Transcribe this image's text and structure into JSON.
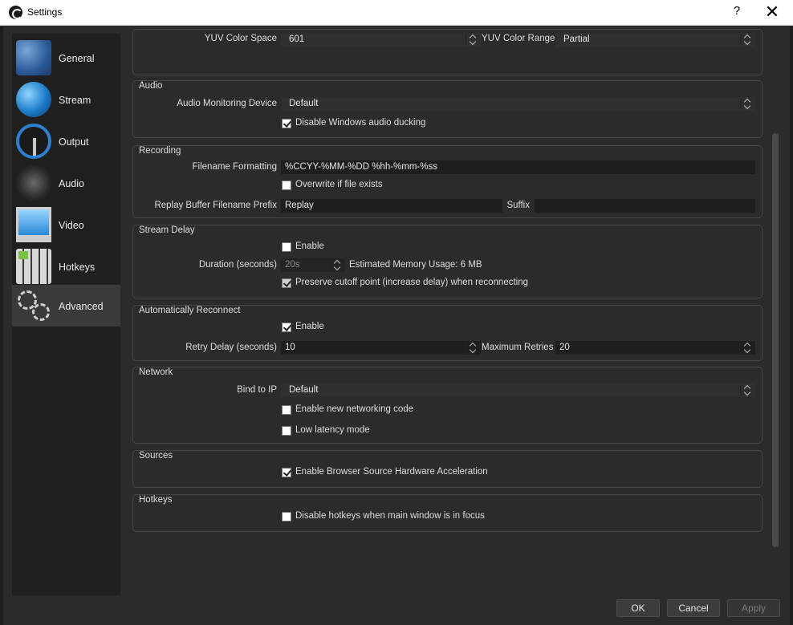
{
  "window": {
    "title": "Settings",
    "help_label": "?",
    "close_label": "✕"
  },
  "sidebar": {
    "items": [
      {
        "label": "General",
        "icon": "general-icon"
      },
      {
        "label": "Stream",
        "icon": "globe-icon"
      },
      {
        "label": "Output",
        "icon": "output-dial-icon"
      },
      {
        "label": "Audio",
        "icon": "speaker-icon"
      },
      {
        "label": "Video",
        "icon": "monitor-icon"
      },
      {
        "label": "Hotkeys",
        "icon": "keyboard-icon"
      },
      {
        "label": "Advanced",
        "icon": "gears-icon"
      }
    ],
    "active": "Advanced"
  },
  "video_top": {
    "color_space_label": "YUV Color Space",
    "color_space_value": "601",
    "color_range_label": "YUV Color Range",
    "color_range_value": "Partial"
  },
  "audio": {
    "title": "Audio",
    "monitoring_label": "Audio Monitoring Device",
    "monitoring_value": "Default",
    "ducking_label": "Disable Windows audio ducking",
    "ducking_checked": true
  },
  "recording": {
    "title": "Recording",
    "filename_label": "Filename Formatting",
    "filename_value": "%CCYY-%MM-%DD %hh-%mm-%ss",
    "overwrite_label": "Overwrite if file exists",
    "overwrite_checked": false,
    "replay_label": "Replay Buffer Filename Prefix",
    "replay_value": "Replay",
    "suffix_label": "Suffix",
    "suffix_value": ""
  },
  "stream_delay": {
    "title": "Stream Delay",
    "enable_label": "Enable",
    "enable_checked": false,
    "duration_label": "Duration (seconds)",
    "duration_value": "20s",
    "memory_label": "Estimated Memory Usage: 6 MB",
    "preserve_label": "Preserve cutoff point (increase delay) when reconnecting",
    "preserve_checked": true
  },
  "reconnect": {
    "title": "Automatically Reconnect",
    "enable_label": "Enable",
    "enable_checked": true,
    "retry_label": "Retry Delay (seconds)",
    "retry_value": "10",
    "max_label": "Maximum Retries",
    "max_value": "20"
  },
  "network": {
    "title": "Network",
    "bind_label": "Bind to IP",
    "bind_value": "Default",
    "new_net_label": "Enable new networking code",
    "new_net_checked": false,
    "low_latency_label": "Low latency mode",
    "low_latency_checked": false
  },
  "sources": {
    "title": "Sources",
    "browser_accel_label": "Enable Browser Source Hardware Acceleration",
    "browser_accel_checked": true
  },
  "hotkeys": {
    "title": "Hotkeys",
    "disable_focus_label": "Disable hotkeys when main window is in focus",
    "disable_focus_checked": false
  },
  "buttons": {
    "ok": "OK",
    "cancel": "Cancel",
    "apply": "Apply"
  }
}
